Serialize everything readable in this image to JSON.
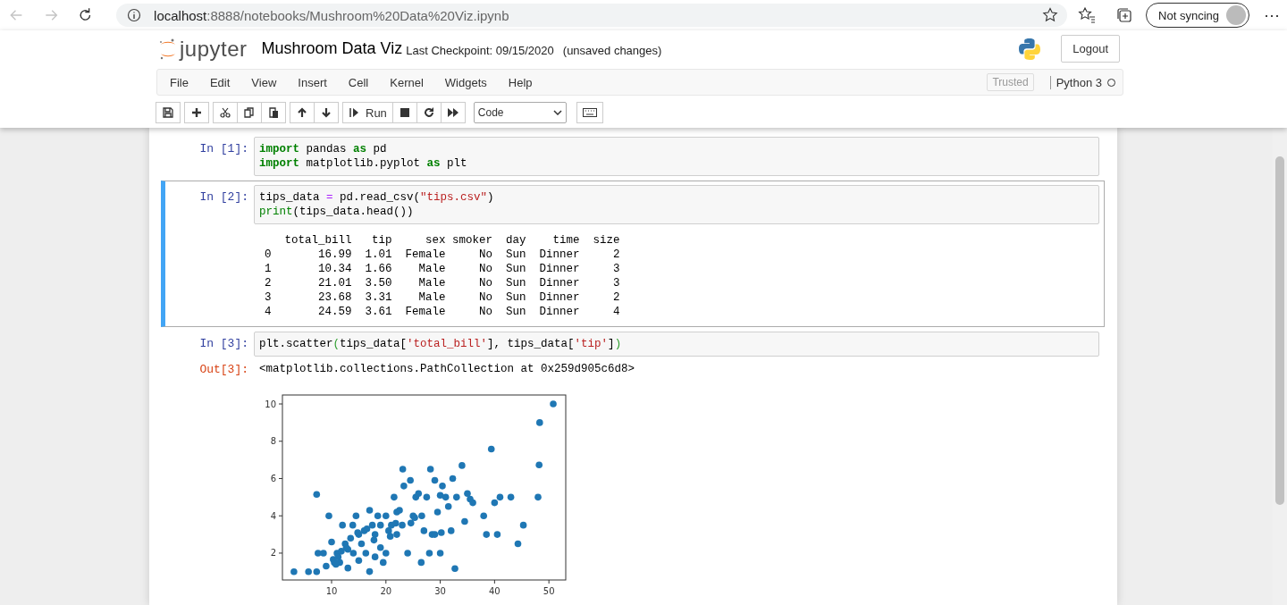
{
  "browser": {
    "back_disabled": true,
    "forward_disabled": true,
    "url_host": "localhost",
    "url_path": ":8888/notebooks/Mushroom%20Data%20Viz.ipynb",
    "sync_label": "Not syncing",
    "more": "⋯"
  },
  "header": {
    "logo_text": "jupyter",
    "title": "Mushroom Data Viz",
    "checkpoint": "Last Checkpoint: 09/15/2020",
    "unsaved": "(unsaved changes)",
    "logout": "Logout"
  },
  "menubar": {
    "items": [
      "File",
      "Edit",
      "View",
      "Insert",
      "Cell",
      "Kernel",
      "Widgets",
      "Help"
    ],
    "trusted": "Trusted",
    "kernel": "Python 3",
    "kernel_busy": false
  },
  "toolbar": {
    "groups": [
      [
        {
          "kind": "save"
        }
      ],
      [
        {
          "kind": "add"
        }
      ],
      [
        {
          "kind": "cut"
        },
        {
          "kind": "copy"
        },
        {
          "kind": "paste"
        }
      ],
      [
        {
          "kind": "up"
        },
        {
          "kind": "down"
        }
      ],
      [
        {
          "kind": "run",
          "label": "Run"
        },
        {
          "kind": "stop"
        },
        {
          "kind": "restart"
        },
        {
          "kind": "fastforward"
        }
      ]
    ],
    "cell_type": "Code"
  },
  "cells": [
    {
      "prompt": "In [1]:",
      "selected": false,
      "code": [
        [
          {
            "text": "import",
            "kind": "keyword"
          },
          {
            "text": " pandas ",
            "kind": "plain"
          },
          {
            "text": "as",
            "kind": "keyword"
          },
          {
            "text": " pd",
            "kind": "plain"
          }
        ],
        [
          {
            "text": "import",
            "kind": "keyword"
          },
          {
            "text": " matplotlib.pyplot ",
            "kind": "plain"
          },
          {
            "text": "as",
            "kind": "keyword"
          },
          {
            "text": " plt",
            "kind": "plain"
          }
        ]
      ]
    },
    {
      "prompt": "In [2]:",
      "selected": true,
      "code": [
        [
          {
            "text": "tips_data ",
            "kind": "plain"
          },
          {
            "text": "=",
            "kind": "operator"
          },
          {
            "text": " pd.read_csv(",
            "kind": "plain"
          },
          {
            "text": "\"tips.csv\"",
            "kind": "string"
          },
          {
            "text": ")",
            "kind": "plain"
          }
        ],
        [
          {
            "text": "print",
            "kind": "builtin"
          },
          {
            "text": "(tips_data.head())",
            "kind": "plain"
          }
        ]
      ],
      "output_lines": [
        "   total_bill   tip     sex smoker  day    time  size",
        "0       16.99  1.01  Female     No  Sun  Dinner     2",
        "1       10.34  1.66    Male     No  Sun  Dinner     3",
        "2       21.01  3.50    Male     No  Sun  Dinner     3",
        "3       23.68  3.31    Male     No  Sun  Dinner     2",
        "4       24.59  3.61  Female     No  Sun  Dinner     4"
      ]
    },
    {
      "prompt": "In [3]:",
      "selected": false,
      "code": [
        [
          {
            "text": "plt.scatter",
            "kind": "plain"
          },
          {
            "text": "(",
            "kind": "bracket"
          },
          {
            "text": "tips_data[",
            "kind": "plain"
          },
          {
            "text": "'total_bill'",
            "kind": "string"
          },
          {
            "text": "], tips_data[",
            "kind": "plain"
          },
          {
            "text": "'tip'",
            "kind": "string"
          },
          {
            "text": "]",
            "kind": "plain"
          },
          {
            "text": ")",
            "kind": "bracket"
          }
        ]
      ],
      "out_prompt": "Out[3]:",
      "result": "<matplotlib.collections.PathCollection at 0x259d905c6d8>",
      "chart_data": {
        "type": "scatter",
        "xlim": [
          0.95,
          53.1
        ],
        "ylim": [
          0.56,
          10.48
        ],
        "xticks": [
          10,
          20,
          30,
          40,
          50
        ],
        "yticks": [
          2,
          4,
          6,
          8,
          10
        ],
        "x": [
          3.07,
          5.75,
          7.25,
          7.25,
          7.5,
          8.5,
          9.5,
          10,
          10.3,
          10.5,
          11,
          11.5,
          12,
          12.5,
          13,
          13,
          13.5,
          13.9,
          14,
          14.5,
          15,
          15,
          16,
          16.3,
          16.99,
          17,
          17.5,
          18,
          18,
          18.5,
          19,
          19.5,
          20,
          20,
          20.5,
          21,
          21.5,
          22,
          22.5,
          23,
          23.1,
          23.3,
          24,
          24.5,
          24.6,
          25,
          25.5,
          26,
          26.5,
          27,
          27.5,
          28,
          28.2,
          28.5,
          29,
          29.5,
          30,
          30,
          30.4,
          31,
          31.5,
          32,
          32.3,
          32.7,
          33,
          34,
          34.5,
          35,
          35.5,
          36,
          38,
          38.5,
          39.4,
          40,
          40.5,
          41,
          43,
          44.3,
          45.3,
          48,
          48.2,
          48.3,
          50.8,
          9,
          11.2,
          12.7,
          15.5,
          19,
          22,
          25.3,
          26.6,
          29,
          30.2,
          10.8,
          11.8,
          14.8,
          16.5,
          17.8,
          20.8,
          21.8
        ],
        "series": [
          {
            "color": "#1f77b4",
            "values": [
              1,
              1,
              1,
              5.15,
              2,
              2,
              4,
              2.6,
              1.66,
              1.5,
              2,
              1.5,
              3.5,
              2.5,
              1.2,
              2.2,
              2.8,
              3.5,
              2,
              4,
              3,
              1.6,
              3.2,
              2,
              1.01,
              4.3,
              3.5,
              3,
              1.8,
              4,
              3.5,
              1.5,
              4,
              2,
              3.2,
              3.5,
              5,
              3,
              4.3,
              3.5,
              6.5,
              5.6,
              2,
              5.9,
              3.61,
              4,
              5,
              5.2,
              1.5,
              3.2,
              5,
              2,
              6.5,
              3,
              5.9,
              4.2,
              5.1,
              2,
              5.6,
              5,
              4.5,
              3.2,
              6,
              1.17,
              5,
              6.7,
              3.7,
              5.2,
              4.9,
              4.7,
              4,
              3,
              7.58,
              4.7,
              3,
              5,
              5,
              2.5,
              3.5,
              5,
              6.73,
              9,
              10,
              1.3,
              1.8,
              2.3,
              2.5,
              2.3,
              4.2,
              3.9,
              4,
              3,
              3.1,
              1.4,
              2.1,
              3.1,
              3.3,
              2.7,
              2.9,
              3.6
            ]
          }
        ]
      }
    }
  ]
}
